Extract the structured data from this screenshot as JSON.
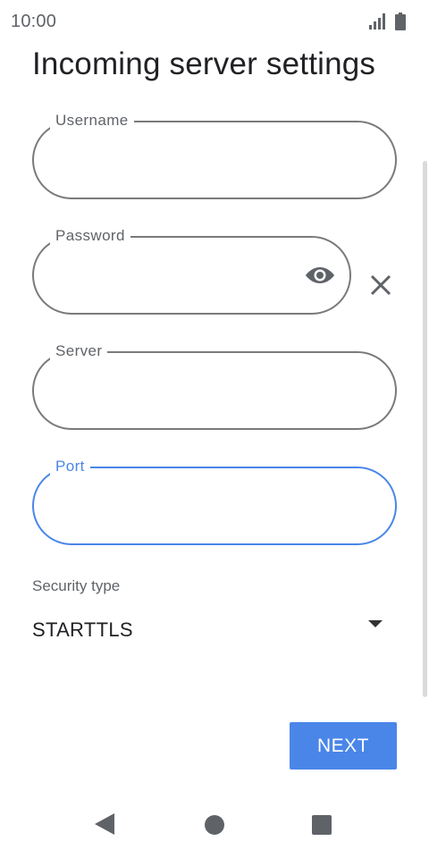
{
  "status_bar": {
    "time": "10:00",
    "signal_icon": "signal-icon",
    "battery_icon": "battery-icon"
  },
  "title": "Incoming server settings",
  "fields": {
    "username": {
      "label": "Username",
      "value": "",
      "placeholder": ""
    },
    "password": {
      "label": "Password",
      "value": "",
      "placeholder": "",
      "visibility_icon": "eye-icon",
      "clear_icon": "close-icon"
    },
    "server": {
      "label": "Server",
      "value": "",
      "placeholder": ""
    },
    "port": {
      "label": "Port",
      "value": "",
      "placeholder": "",
      "focused": true
    }
  },
  "security": {
    "label": "Security type",
    "value": "STARTTLS",
    "dropdown_icon": "dropdown-arrow-icon"
  },
  "next_button": {
    "label": "NEXT"
  },
  "navigation": {
    "back_icon": "back-icon",
    "home_icon": "home-icon",
    "recents_icon": "recents-icon"
  },
  "colors": {
    "accent": "#4a86e8",
    "outline": "#7a7a7a",
    "text": "#202124",
    "secondary_text": "#5f6368"
  }
}
